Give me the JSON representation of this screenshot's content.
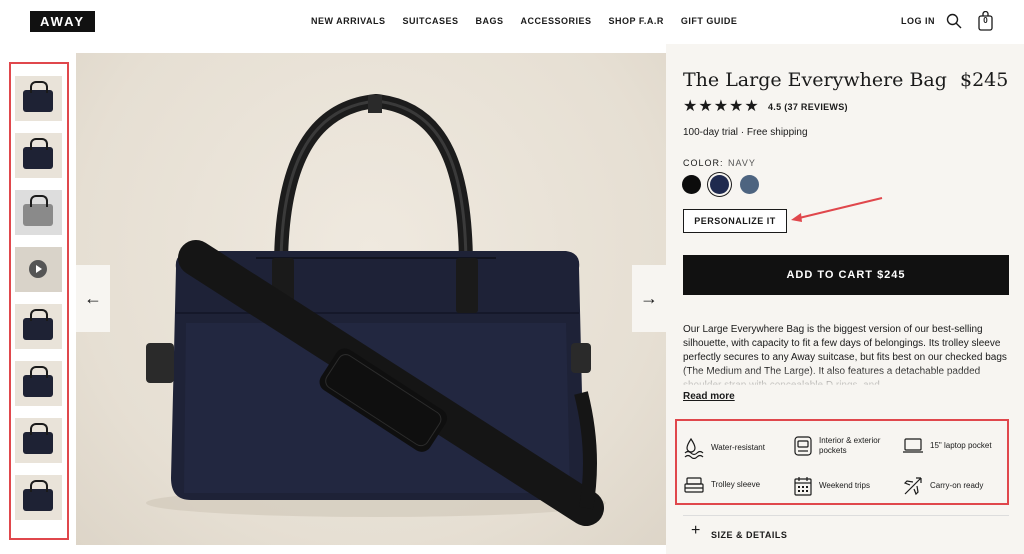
{
  "header": {
    "logo": "AWAY",
    "nav": [
      "NEW ARRIVALS",
      "SUITCASES",
      "BAGS",
      "ACCESSORIES",
      "SHOP F.A.R",
      "GIFT GUIDE"
    ],
    "login": "LOG IN",
    "cart_count": "0"
  },
  "gallery": {
    "thumbnails": [
      "navy-front",
      "navy-angle",
      "interior-open",
      "video",
      "navy-side",
      "navy-on-suitcase",
      "navy-strap",
      "navy-lifestyle"
    ],
    "prev_icon": "←",
    "next_icon": "→"
  },
  "product": {
    "title": "The Large Everywhere Bag",
    "price": "$245",
    "rating_text": "4.5 (37 REVIEWS)",
    "stars": [
      "★",
      "★",
      "★",
      "★",
      "★"
    ],
    "trial": "100-day trial · Free shipping",
    "color_label": "COLOR:",
    "color_value": "NAVY",
    "swatches": [
      "#0c0c0c",
      "#1f2a4f",
      "#4d6480"
    ],
    "personalize_label": "PERSONALIZE IT",
    "add_to_cart_label": "ADD TO CART $245",
    "description": "Our Large Everywhere Bag is the biggest version of our best-selling silhouette, with capacity to fit a few days of belongings. Its trolley sleeve perfectly secures to any Away suitcase, but fits best on our checked bags (The Medium and The Large). It also features a detachable padded shoulder strap with concealable D rings, and",
    "read_more": "Read more",
    "features": [
      {
        "icon": "water-drop-icon",
        "label": "Water-resistant"
      },
      {
        "icon": "pockets-icon",
        "label": "Interior & exterior pockets"
      },
      {
        "icon": "laptop-icon",
        "label": "15\" laptop pocket"
      },
      {
        "icon": "trolley-sleeve-icon",
        "label": "Trolley sleeve"
      },
      {
        "icon": "calendar-icon",
        "label": "Weekend trips"
      },
      {
        "icon": "airplane-icon",
        "label": "Carry-on ready"
      }
    ],
    "size_details_label": "SIZE & DETAILS",
    "size_details_icon": "+"
  },
  "colors": {
    "accent_red": "#e0474c",
    "button_black": "#111111",
    "panel_bg": "#f7f5f1"
  }
}
